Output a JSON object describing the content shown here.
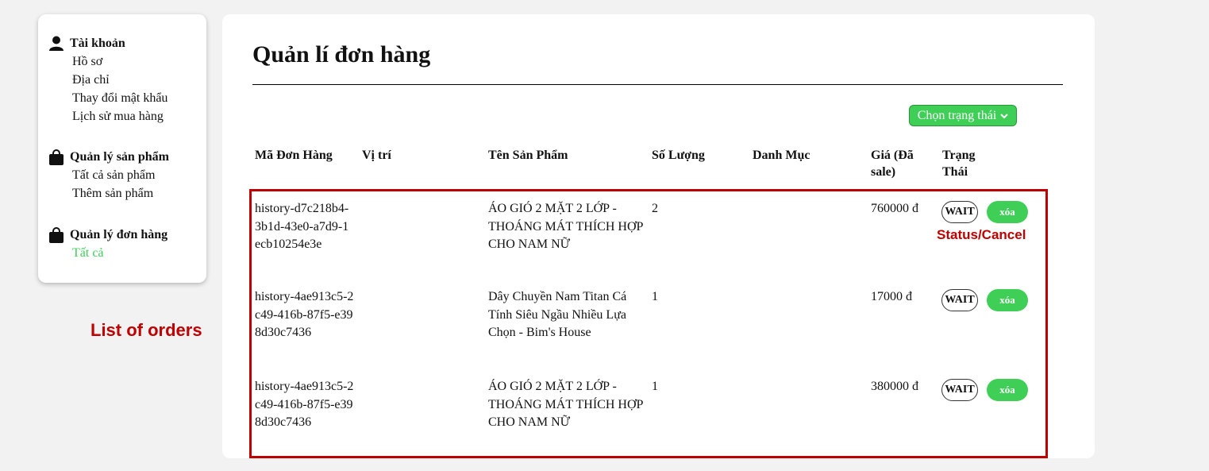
{
  "sidebar": {
    "account": {
      "title": "Tài khoản",
      "items": [
        "Hồ sơ",
        "Địa chỉ",
        "Thay đổi mật khẩu",
        "Lịch sử mua hàng"
      ]
    },
    "products": {
      "title": "Quản lý sản phẩm",
      "items": [
        "Tất cả sản phẩm",
        "Thêm sản phẩm"
      ]
    },
    "orders": {
      "title": "Quản lý đơn hàng",
      "items": [
        "Tất cả"
      ]
    },
    "icons": [
      "user-icon",
      "shopping-bag-icon",
      "shopping-bag-icon"
    ]
  },
  "main": {
    "title": "Quản lí đơn hàng",
    "status_filter_label": "Chọn trạng thái",
    "columns": [
      "Mã Đơn Hàng",
      "Vị trí",
      "Tên Sản Phẩm",
      "Số Lượng",
      "Danh Mục",
      "Giá (Đã sale)",
      "Trạng Thái"
    ],
    "rows": [
      {
        "id": "history-d7c218b4-3b1d-43e0-a7d9-1ecb10254e3e",
        "location": "",
        "product": "ÁO GIÓ 2 MẶT 2 LỚP - THOÁNG MÁT THÍCH HỢP CHO NAM NỮ",
        "quantity": "2",
        "category": "",
        "price": "760000 đ",
        "status": "WAIT",
        "delete_label": "xóa"
      },
      {
        "id": "history-4ae913c5-2c49-416b-87f5-e398d30c7436",
        "location": "",
        "product": "Dây Chuyền Nam Titan Cá Tính Siêu Ngầu Nhiều Lựa Chọn - Bim's House",
        "quantity": "1",
        "category": "",
        "price": "17000 đ",
        "status": "WAIT",
        "delete_label": "xóa"
      },
      {
        "id": "history-4ae913c5-2c49-416b-87f5-e398d30c7436",
        "location": "",
        "product": "ÁO GIÓ 2 MẶT 2 LỚP - THOÁNG MÁT THÍCH HỢP CHO NAM NỮ",
        "quantity": "1",
        "category": "",
        "price": "380000 đ",
        "status": "WAIT",
        "delete_label": "xóa"
      }
    ]
  },
  "annotations": {
    "list_label": "List of orders",
    "status_label": "Status/Cancel",
    "color": "#c00000"
  },
  "colors": {
    "accent": "#3fcf57",
    "background": "#f2f2f2"
  }
}
